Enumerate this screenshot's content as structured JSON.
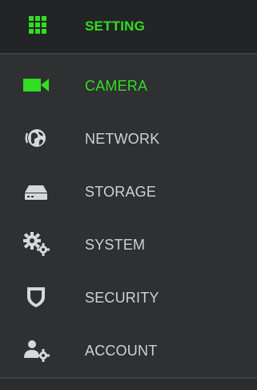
{
  "header": {
    "title": "SETTING",
    "icon": "grid-icon"
  },
  "menu": {
    "items": [
      {
        "label": "CAMERA",
        "icon": "camera-icon",
        "active": true
      },
      {
        "label": "NETWORK",
        "icon": "globe-network-icon",
        "active": false
      },
      {
        "label": "STORAGE",
        "icon": "hard-drive-icon",
        "active": false
      },
      {
        "label": "SYSTEM",
        "icon": "gears-icon",
        "active": false
      },
      {
        "label": "SECURITY",
        "icon": "shield-icon",
        "active": false
      },
      {
        "label": "ACCOUNT",
        "icon": "user-settings-icon",
        "active": false
      }
    ]
  },
  "colors": {
    "accent": "#33dd22",
    "text": "#cfd2d3",
    "background": "#2e3031",
    "header_background": "#222425"
  }
}
